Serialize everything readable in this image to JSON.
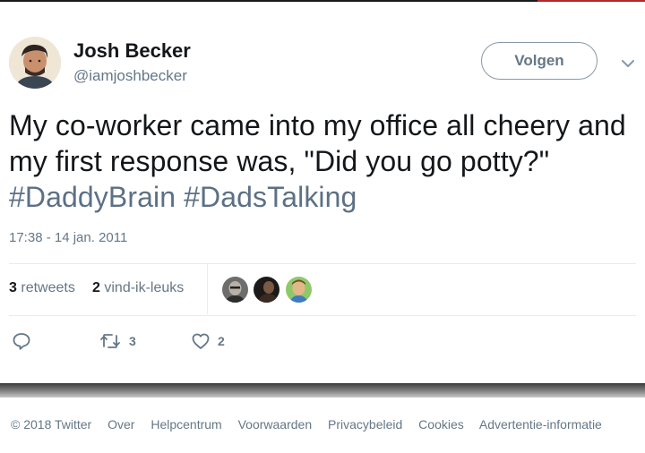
{
  "user": {
    "name": "Josh Becker",
    "handle": "@iamjoshbecker"
  },
  "follow_button": {
    "label": "Volgen"
  },
  "tweet": {
    "text": "My co-worker came into my office all cheery and my first response was, \"Did you go potty?\" ",
    "hashtags": [
      "#DaddyBrain",
      "#DadsTalking"
    ],
    "timestamp": "17:38 - 14 jan. 2011"
  },
  "stats": {
    "retweets_count": "3",
    "retweets_label": "retweets",
    "likes_count": "2",
    "likes_label": "vind-ik-leuks"
  },
  "actions": {
    "reply_icon": "reply-icon",
    "retweet_count": "3",
    "like_count": "2"
  },
  "footer": {
    "copyright": "© 2018 Twitter",
    "links": [
      "Over",
      "Helpcentrum",
      "Voorwaarden",
      "Privacybeleid",
      "Cookies",
      "Advertentie-informatie"
    ]
  },
  "colors": {
    "hashtag": "#5c7086",
    "secondary_text": "#657786",
    "divider": "#e6ecf0"
  }
}
